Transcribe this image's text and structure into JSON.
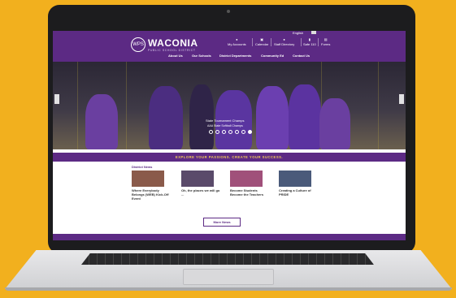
{
  "page": {
    "background": "#f2b01e"
  },
  "site": {
    "brand": "WACONIA",
    "brand_sub": "PUBLIC SCHOOL DISTRICT",
    "language_label": "English",
    "utility_nav": [
      {
        "label": "My Accounts",
        "icon": "user-icon"
      },
      {
        "label": "Calendar",
        "icon": "calendar-icon"
      },
      {
        "label": "Staff Directory",
        "icon": "people-icon"
      },
      {
        "label": "Safe 110",
        "icon": "phone-icon"
      },
      {
        "label": "Forms",
        "icon": "document-icon"
      }
    ],
    "main_nav": [
      "About Us",
      "Our Schools",
      "District Departments",
      "Community Ed",
      "Contact Us"
    ],
    "hero": {
      "caption_title": "State Tournament Champs",
      "caption_sub": "AAA State Softball Champs",
      "slide_count": 7,
      "active_slide": 7
    },
    "tagline": "EXPLORE YOUR PASSIONS. CREATE YOUR SUCCESS.",
    "news": {
      "heading": "District News",
      "items": [
        {
          "title": "Where Everybody Belongs (WEB) Kick-Off Event",
          "thumb_color": "#8a5a4a"
        },
        {
          "title": "Oh, the places we will go ...",
          "thumb_color": "#5a4a6a"
        },
        {
          "title": "Become Students Become the Teachers",
          "thumb_color": "#a0507a"
        },
        {
          "title": "Creating a Culture of PRIDE",
          "thumb_color": "#4a5a7a"
        }
      ],
      "more_label": "More News"
    },
    "colors": {
      "brand_purple": "#5c2a84",
      "accent_gold": "#f0c85a"
    }
  }
}
